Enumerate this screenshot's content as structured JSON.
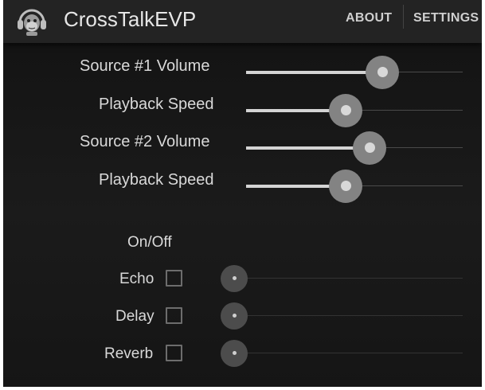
{
  "app_bar": {
    "title": "CrossTalkEVP",
    "logo_icon": "monkey-headphones-icon",
    "menu": [
      {
        "label": "ABOUT"
      },
      {
        "label": "SETTINGS"
      }
    ]
  },
  "controls": {
    "source1_volume": {
      "label": "Source #1 Volume",
      "value_fraction": 0.63
    },
    "source1_speed": {
      "label": "Playback Speed",
      "value_fraction": 0.46
    },
    "source2_volume": {
      "label": "Source #2 Volume",
      "value_fraction": 0.57
    },
    "source2_speed": {
      "label": "Playback Speed",
      "value_fraction": 0.46
    }
  },
  "effects": {
    "header": "On/Off",
    "items": [
      {
        "label": "Echo",
        "checked": false,
        "level_fraction": 0.0
      },
      {
        "label": "Delay",
        "checked": false,
        "level_fraction": 0.0
      },
      {
        "label": "Reverb",
        "checked": false,
        "level_fraction": 0.0
      }
    ]
  },
  "colors": {
    "background": "#151515",
    "app_bar": "#232323",
    "text": "#d9d9d9",
    "slider_fill": "#d4d4d4",
    "slider_halo": "#838383"
  }
}
